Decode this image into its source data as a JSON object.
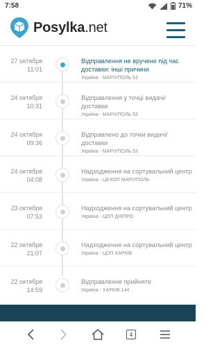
{
  "status_bar": {
    "time": "7:58",
    "battery": "71%"
  },
  "brand": {
    "name_bold": "Posylka",
    "name_tail": ".net"
  },
  "timeline": [
    {
      "date": "27 октября",
      "time": "11:01",
      "status": "Відправлення не вручене під час доставки: інші причини",
      "location": "Україна - МАРІУПОЛЬ 53",
      "active": true
    },
    {
      "date": "24 октября",
      "time": "10:31",
      "status": "Відправлення у точці видачі/доставки",
      "location": "Україна - МАРІУПОЛЬ 53",
      "active": false
    },
    {
      "date": "24 октября",
      "time": "09:36",
      "status": "Відправлено до точки видачі/доставки",
      "location": "Україна - МАРІУПОЛЬ 53",
      "active": false
    },
    {
      "date": "24 октября",
      "time": "04:08",
      "status": "Надходження на сортувальний центр",
      "location": "Україна - ЦЕХОП МАРІУПОЛЬ",
      "active": false
    },
    {
      "date": "23 октября",
      "time": "07:53",
      "status": "Надходження на сортувальний центр",
      "location": "Україна - ЦОП ДНІПРО",
      "active": false
    },
    {
      "date": "22 октября",
      "time": "21:07",
      "status": "Надходження на сортувальний центр",
      "location": "Україна - ЦОП ХАРКІВ",
      "active": false
    },
    {
      "date": "22 октября",
      "time": "14:59",
      "status": "Відправлення прийняте",
      "location": "Україна - ХАРКІВ 144",
      "active": false
    }
  ],
  "navbar": {
    "tabs_count": "4"
  },
  "icons": {
    "wifi": "wifi-icon",
    "signal": "signal-icon",
    "battery": "battery-icon",
    "logo": "logo-pin-icon",
    "menu": "hamburger-menu-icon",
    "back": "back-arrow-icon",
    "forward": "forward-arrow-icon",
    "home": "home-icon",
    "tabs": "tabs-icon",
    "menu_nav": "browser-menu-icon"
  },
  "colors": {
    "accent": "#3aa4cd",
    "brand_dark": "#1a5e77",
    "footer": "#1a4358"
  }
}
